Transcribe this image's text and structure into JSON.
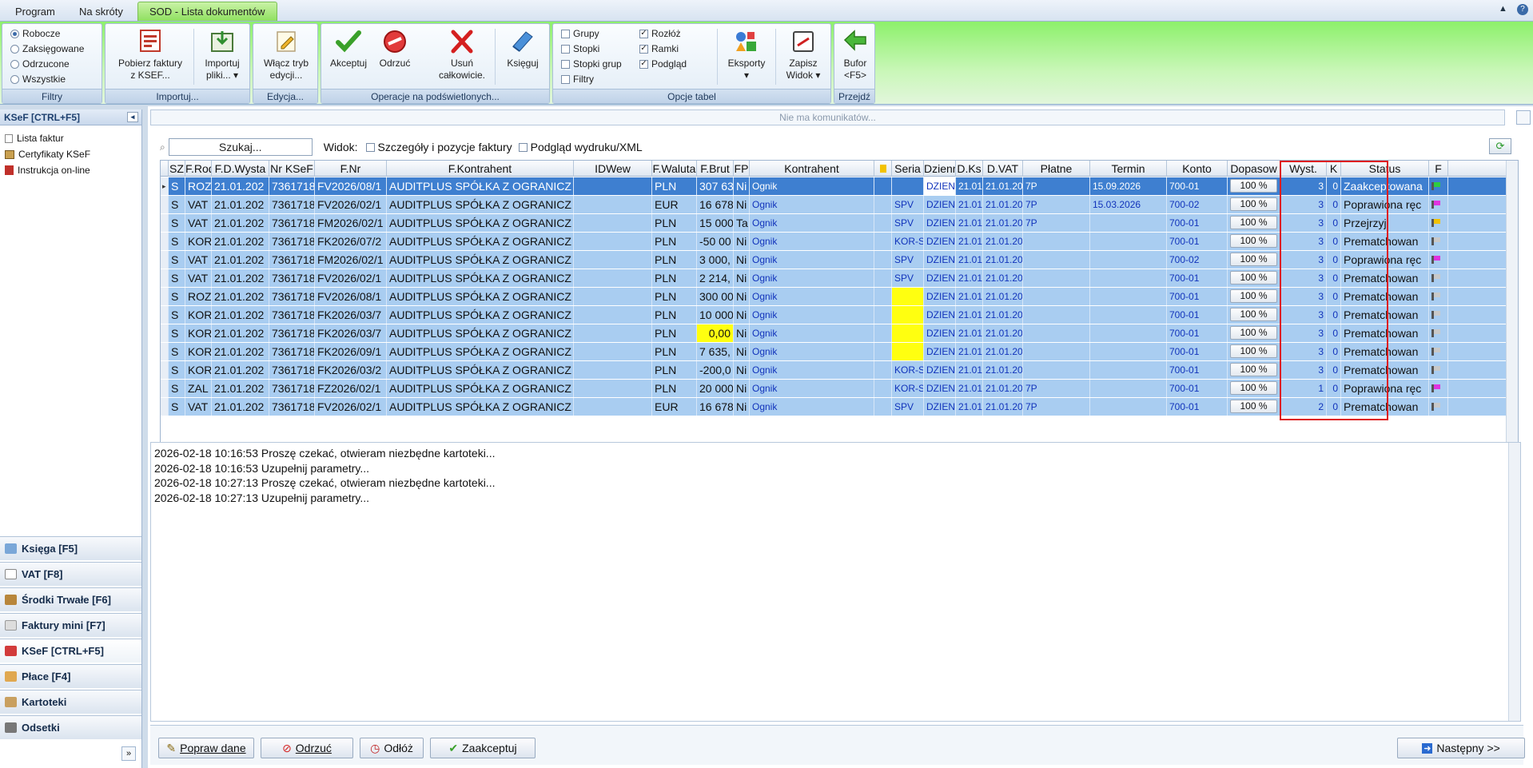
{
  "tabs": [
    {
      "label": "Program"
    },
    {
      "label": "Na skróty"
    },
    {
      "label": "SOD - Lista dokumentów"
    }
  ],
  "ribbon": {
    "filters": {
      "caption": "Filtry",
      "options": [
        "Robocze",
        "Zaksięgowane",
        "Odrzucone",
        "Wszystkie"
      ],
      "selected": 0
    },
    "import": {
      "caption": "Importuj...",
      "pobierz1": "Pobierz faktury",
      "pobierz2": "z KSEF...",
      "importuj1": "Importuj",
      "importuj2": "pliki... ▾"
    },
    "edit": {
      "caption": "Edycja...",
      "label1": "Włącz tryb",
      "label2": "edycji..."
    },
    "ops": {
      "caption": "Operacje na podświetlonych...",
      "akceptuj": "Akceptuj",
      "odrzuc": "Odrzuć",
      "usun1": "Usuń",
      "usun2": "całkowicie.",
      "ksieguj": "Księguj"
    },
    "table": {
      "caption": "Opcje tabel",
      "grupy": "Grupy",
      "stopki": "Stopki",
      "stopkigrup": "Stopki grup",
      "filtry": "Filtry",
      "rozloz": "Rozłóż",
      "ramki": "Ramki",
      "podglad": "Podgląd",
      "eksporty": "Eksporty",
      "eksporty2": "▾",
      "zapisz1": "Zapisz",
      "zapisz2": "Widok ▾"
    },
    "goto": {
      "caption": "Przejdź",
      "bufor1": "Bufor",
      "bufor2": "<F5>"
    }
  },
  "left": {
    "header": "KSeF [CTRL+F5]",
    "items": [
      "Lista faktur",
      "Certyfikaty KSeF",
      "Instrukcja on-line"
    ],
    "nav": [
      "Księga [F5]",
      "VAT [F8]",
      "Środki Trwałe [F6]",
      "Faktury mini [F7]",
      "KSeF [CTRL+F5]",
      "Płace [F4]",
      "Kartoteki",
      "Odsetki"
    ]
  },
  "messages": "Nie ma komunikatów...",
  "search": {
    "placeholder": "Szukaj...",
    "widok": "Widok:",
    "opt1": "Szczegóły i pozycje faktury",
    "opt2": "Podgląd wydruku/XML"
  },
  "columns": [
    "",
    "SZ",
    "F.Rod",
    "F.D.Wysta",
    "Nr KSeF",
    "F.Nr",
    "F.Kontrahent",
    "IDWew",
    "F.Waluta",
    "F.Brut",
    "FP",
    "Kontrahent",
    "",
    "Seria",
    "Dzienn",
    "D.Ks",
    "D.VAT",
    "Płatne",
    "Termin",
    "Konto",
    "Dopasow",
    "Wyst.",
    "K",
    "Status",
    "F"
  ],
  "rows": [
    {
      "sz": "S",
      "rod": "ROZ",
      "dw": "21.01.202",
      "ksef": "7361718",
      "nr": "FV2026/08/1",
      "kon": "AUDITPLUS SPÓŁKA Z OGRANICZ",
      "wal": "PLN",
      "brut": "307 63",
      "fp": "Ni",
      "k2": "Ognik",
      "seria": "",
      "dz": "DZIENN",
      "dks": "21.01",
      "dvat": "21.01.20",
      "plat": "7P",
      "term": "15.09.2026",
      "konto": "700-01",
      "dop": "100 %",
      "wyst": "3",
      "k": "0",
      "status": "Zaakceptowana",
      "flag": "#2ecc40"
    },
    {
      "sz": "S",
      "rod": "VAT",
      "dw": "21.01.202",
      "ksef": "7361718",
      "nr": "FV2026/02/1",
      "kon": "AUDITPLUS SPÓŁKA Z OGRANICZ",
      "wal": "EUR",
      "brut": "16 678",
      "fp": "Ni",
      "k2": "Ognik",
      "seria": "SPV",
      "dz": "DZIENN",
      "dks": "21.01",
      "dvat": "21.01.20",
      "plat": "7P",
      "term": "15.03.2026",
      "konto": "700-02",
      "dop": "100 %",
      "wyst": "3",
      "k": "0",
      "status": "Poprawiona ręc",
      "flag": "#e033e0"
    },
    {
      "sz": "S",
      "rod": "VAT",
      "dw": "21.01.202",
      "ksef": "7361718",
      "nr": "FM2026/02/1",
      "kon": "AUDITPLUS SPÓŁKA Z OGRANICZ",
      "wal": "PLN",
      "brut": "15 000",
      "fp": "Ta",
      "k2": "Ognik",
      "seria": "SPV",
      "dz": "DZIENN",
      "dks": "21.01",
      "dvat": "21.01.20",
      "plat": "7P",
      "term": "",
      "konto": "700-01",
      "dop": "100 %",
      "wyst": "3",
      "k": "0",
      "status": "Przejrzyj",
      "flag": "#f2c200"
    },
    {
      "sz": "S",
      "rod": "KOR",
      "dw": "21.01.202",
      "ksef": "7361718",
      "nr": "FK2026/07/2",
      "kon": "AUDITPLUS SPÓŁKA Z OGRANICZ",
      "wal": "PLN",
      "brut": "-50 00",
      "fp": "Ni",
      "k2": "Ognik",
      "seria": "KOR-S",
      "dz": "DZIENN",
      "dks": "21.01",
      "dvat": "21.01.20",
      "plat": "",
      "term": "",
      "konto": "700-01",
      "dop": "100 %",
      "wyst": "3",
      "k": "0",
      "status": "Prematchowan",
      "flag": "#c9c9c9"
    },
    {
      "sz": "S",
      "rod": "VAT",
      "dw": "21.01.202",
      "ksef": "7361718",
      "nr": "FM2026/02/1",
      "kon": "AUDITPLUS SPÓŁKA Z OGRANICZ",
      "wal": "PLN",
      "brut": "3 000,",
      "fp": "Ni",
      "k2": "Ognik",
      "seria": "SPV",
      "dz": "DZIENN",
      "dks": "21.01",
      "dvat": "21.01.20",
      "plat": "",
      "term": "",
      "konto": "700-02",
      "dop": "100 %",
      "wyst": "3",
      "k": "0",
      "status": "Poprawiona ręc",
      "flag": "#e033e0"
    },
    {
      "sz": "S",
      "rod": "VAT",
      "dw": "21.01.202",
      "ksef": "7361718",
      "nr": "FV2026/02/1",
      "kon": "AUDITPLUS SPÓŁKA Z OGRANICZ",
      "wal": "PLN",
      "brut": "2 214,",
      "fp": "Ni",
      "k2": "Ognik",
      "seria": "SPV",
      "dz": "DZIENN",
      "dks": "21.01",
      "dvat": "21.01.20",
      "plat": "",
      "term": "",
      "konto": "700-01",
      "dop": "100 %",
      "wyst": "3",
      "k": "0",
      "status": "Prematchowan",
      "flag": "#c9c9c9"
    },
    {
      "sz": "S",
      "rod": "ROZ",
      "dw": "21.01.202",
      "ksef": "7361718",
      "nr": "FV2026/08/1",
      "kon": "AUDITPLUS SPÓŁKA Z OGRANICZ",
      "wal": "PLN",
      "brut": "300 00",
      "fp": "Ni",
      "k2": "Ognik",
      "seria": "",
      "dz": "DZIENN",
      "dks": "21.01",
      "dvat": "21.01.20",
      "plat": "",
      "term": "",
      "konto": "700-01",
      "dop": "100 %",
      "wyst": "3",
      "k": "0",
      "status": "Prematchowan",
      "flag": "#c9c9c9",
      "seriaYel": true
    },
    {
      "sz": "S",
      "rod": "KOR_",
      "dw": "21.01.202",
      "ksef": "7361718",
      "nr": "FK2026/03/7",
      "kon": "AUDITPLUS SPÓŁKA Z OGRANICZ",
      "wal": "PLN",
      "brut": "10 000",
      "fp": "Ni",
      "k2": "Ognik",
      "seria": "",
      "dz": "DZIENN",
      "dks": "21.01",
      "dvat": "21.01.20",
      "plat": "",
      "term": "",
      "konto": "700-01",
      "dop": "100 %",
      "wyst": "3",
      "k": "0",
      "status": "Prematchowan",
      "flag": "#c9c9c9",
      "seriaYel": true
    },
    {
      "sz": "S",
      "rod": "KOR_",
      "dw": "21.01.202",
      "ksef": "7361718",
      "nr": "FK2026/03/7",
      "kon": "AUDITPLUS SPÓŁKA Z OGRANICZ",
      "wal": "PLN",
      "brut": "0,00",
      "fp": "Ni",
      "k2": "Ognik",
      "seria": "",
      "dz": "DZIENN",
      "dks": "21.01",
      "dvat": "21.01.20",
      "plat": "",
      "term": "",
      "konto": "700-01",
      "dop": "100 %",
      "wyst": "3",
      "k": "0",
      "status": "Prematchowan",
      "flag": "#c9c9c9",
      "seriaYel": true,
      "brutYel": true
    },
    {
      "sz": "S",
      "rod": "KOR_",
      "dw": "21.01.202",
      "ksef": "7361718",
      "nr": "FK2026/09/1",
      "kon": "AUDITPLUS SPÓŁKA Z OGRANICZ",
      "wal": "PLN",
      "brut": "7 635,",
      "fp": "Ni",
      "k2": "Ognik",
      "seria": "",
      "dz": "DZIENN",
      "dks": "21.01",
      "dvat": "21.01.20",
      "plat": "",
      "term": "",
      "konto": "700-01",
      "dop": "100 %",
      "wyst": "3",
      "k": "0",
      "status": "Prematchowan",
      "flag": "#c9c9c9",
      "seriaYel": true
    },
    {
      "sz": "S",
      "rod": "KOR",
      "dw": "21.01.202",
      "ksef": "7361718",
      "nr": "FK2026/03/2",
      "kon": "AUDITPLUS SPÓŁKA Z OGRANICZ",
      "wal": "PLN",
      "brut": "-200,0",
      "fp": "Ni",
      "k2": "Ognik",
      "seria": "KOR-S",
      "dz": "DZIENN",
      "dks": "21.01",
      "dvat": "21.01.20",
      "plat": "",
      "term": "",
      "konto": "700-01",
      "dop": "100 %",
      "wyst": "3",
      "k": "0",
      "status": "Prematchowan",
      "flag": "#c9c9c9"
    },
    {
      "sz": "S",
      "rod": "ZAL",
      "dw": "21.01.202",
      "ksef": "7361718",
      "nr": "FZ2026/02/1",
      "kon": "AUDITPLUS SPÓŁKA Z OGRANICZ",
      "wal": "PLN",
      "brut": "20 000",
      "fp": "Ni",
      "k2": "Ognik",
      "seria": "KOR-S",
      "dz": "DZIENN",
      "dks": "21.01",
      "dvat": "21.01.20",
      "plat": "7P",
      "term": "",
      "konto": "700-01",
      "dop": "100 %",
      "wyst": "1",
      "k": "0",
      "status": "Poprawiona ręc",
      "flag": "#e033e0"
    },
    {
      "sz": "S",
      "rod": "VAT",
      "dw": "21.01.202",
      "ksef": "7361718",
      "nr": "FV2026/02/1",
      "kon": "AUDITPLUS SPÓŁKA Z OGRANICZ",
      "wal": "EUR",
      "brut": "16 678",
      "fp": "Ni",
      "k2": "Ognik",
      "seria": "SPV",
      "dz": "DZIENN",
      "dks": "21.01",
      "dvat": "21.01.20",
      "plat": "7P",
      "term": "",
      "konto": "700-01",
      "dop": "100 %",
      "wyst": "2",
      "k": "0",
      "status": "Prematchowan",
      "flag": "#c9c9c9"
    }
  ],
  "log": [
    "2026-02-18 10:16:53 Proszę czekać, otwieram niezbędne kartoteki...",
    "2026-02-18 10:16:53 Uzupełnij parametry...",
    "2026-02-18 10:27:13 Proszę czekać, otwieram niezbędne kartoteki...",
    "2026-02-18 10:27:13 Uzupełnij parametry..."
  ],
  "actions": {
    "popraw": "Popraw dane",
    "odrzuc": "Odrzuć",
    "odloz": "Odłóż",
    "zaakceptuj": "Zaakceptuj",
    "nastepny": "Następny >>"
  }
}
